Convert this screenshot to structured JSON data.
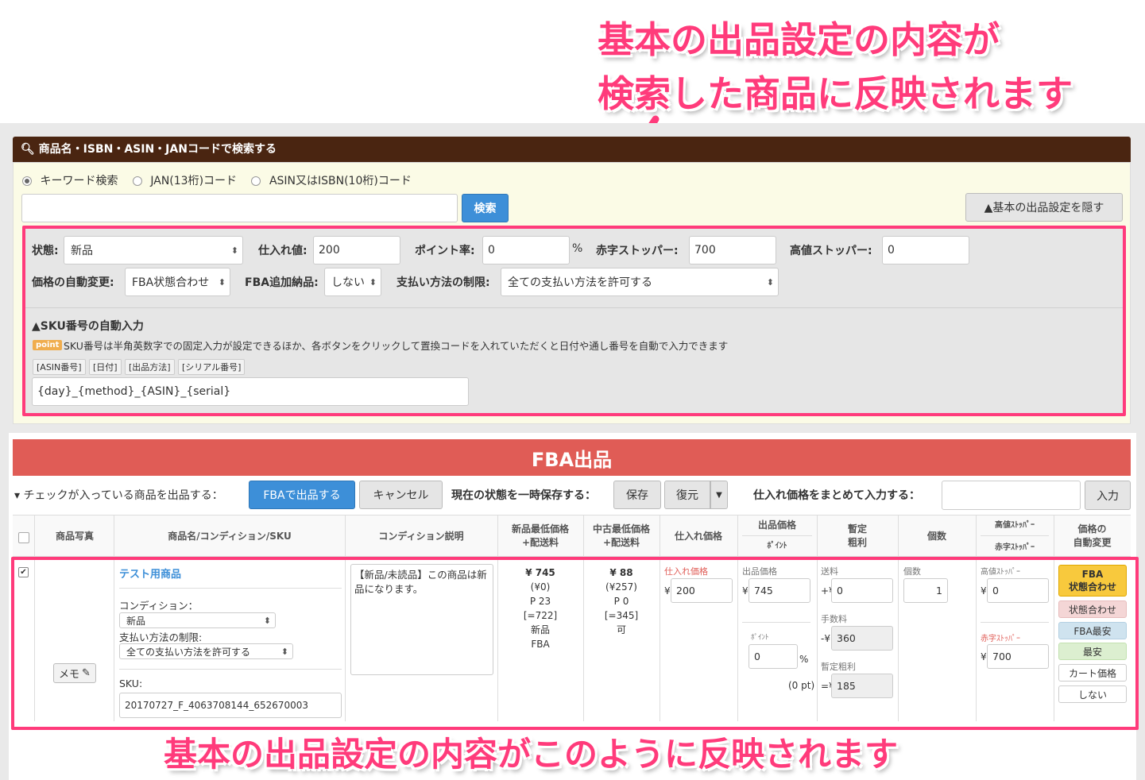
{
  "annotations": {
    "top_line1": "基本の出品設定の内容が",
    "top_line2": "検索した商品に反映されます",
    "bottom": "基本の出品設定の内容がこのように反映されます"
  },
  "search": {
    "header": "商品名・ISBN・ASIN・JANコードで検索する",
    "radio_keyword": "キーワード検索",
    "radio_jan": "JAN(13桁)コード",
    "radio_asin": "ASIN又はISBN(10桁)コード",
    "button": "検索",
    "hide_settings": "▲基本の出品設定を隠す"
  },
  "settings": {
    "condition_label": "状態:",
    "condition_value": "新品",
    "cost_label": "仕入れ値:",
    "cost_value": "200",
    "point_label": "ポイント率:",
    "point_value": "0",
    "point_unit": "%",
    "red_stopper_label": "赤字ストッパー:",
    "red_stopper_value": "700",
    "high_stopper_label": "高値ストッパー:",
    "high_stopper_value": "0",
    "auto_price_label": "価格の自動変更:",
    "auto_price_value": "FBA状態合わせ",
    "fba_add_label": "FBA追加納品:",
    "fba_add_value": "しない",
    "payment_label": "支払い方法の制限:",
    "payment_value": "全ての支払い方法を許可する",
    "sku_title": "▲SKU番号の自動入力",
    "point_badge": "point",
    "sku_desc": "SKU番号は半角英数字での固定入力が設定できるほか、各ボタンをクリックして置換コードを入れていただくと日付や通し番号を自動で入力できます",
    "tags": [
      "[ASIN番号]",
      "[日付]",
      "[出品方法]",
      "[シリアル番号]"
    ],
    "sku_template": "{day}_{method}_{ASIN}_{serial}"
  },
  "fba": {
    "title": "FBA出品",
    "toolbar_label": "▾ チェックが入っている商品を出品する：",
    "btn_fba": "FBAで出品する",
    "btn_cancel": "キャンセル",
    "save_label": "現在の状態を一時保存する：",
    "btn_save": "保存",
    "btn_restore": "復元",
    "bulk_label": "仕入れ価格をまとめて入力する：",
    "btn_input": "入力"
  },
  "table": {
    "headers": {
      "photo": "商品写真",
      "name": "商品名/コンディション/SKU",
      "cond_desc": "コンディション説明",
      "new_low_1": "新品最低価格",
      "new_low_2": "+配送料",
      "used_low_1": "中古最低価格",
      "used_low_2": "+配送料",
      "cost": "仕入れ価格",
      "price_1": "出品価格",
      "price_2": "ﾎﾟｲﾝﾄ",
      "profit_1": "暫定",
      "profit_2": "粗利",
      "qty": "個数",
      "high_1": "高値ｽﾄｯﾊﾟｰ",
      "high_2": "赤字ｽﾄｯﾊﾟｰ",
      "auto_1": "価格の",
      "auto_2": "自動変更"
    },
    "row": {
      "product_name": "テスト用商品",
      "memo": "メモ",
      "condition_label": "コンディション：",
      "condition_value": "新品",
      "payment_label": "支払い方法の制限:",
      "payment_value": "全ての支払い方法を許可する",
      "sku_label": "SKU:",
      "sku_value": "20170727_F_4063708144_652670003",
      "cond_desc": "【新品/未読品】この商品は新品になります。",
      "new_price": "¥ 745",
      "new_ship": "(¥0)",
      "new_point": "P 23",
      "new_net": "[=722]",
      "new_cond": "新品",
      "new_fba": "FBA",
      "used_price": "¥ 88",
      "used_ship": "(¥257)",
      "used_point": "P 0",
      "used_net": "[=345]",
      "used_cond": "可",
      "cost_label": "仕入れ価格",
      "cost_value": "200",
      "yen": "¥",
      "price_label": "出品価格",
      "price_value": "745",
      "point_label": "ﾎﾟｲﾝﾄ",
      "point_value": "0",
      "point_unit": "%",
      "point_pt": "(0 pt)",
      "ship_label": "送料",
      "ship_prefix": "+¥",
      "ship_value": "0",
      "fee_label": "手数料",
      "fee_prefix": "-¥",
      "fee_value": "360",
      "profit_label": "暫定粗利",
      "profit_prefix": "=¥",
      "profit_value": "185",
      "qty_label": "個数",
      "qty_value": "1",
      "high_label": "高値ｽﾄｯﾊﾟｰ",
      "high_value": "0",
      "red_label": "赤字ｽﾄｯﾊﾟｰ",
      "red_value": "700",
      "auto_buttons": [
        "FBA\n状態合わせ",
        "状態合わせ",
        "FBA最安",
        "最安",
        "カート価格",
        "しない"
      ]
    }
  },
  "colors": {
    "accent_pink": "#ff3b7b",
    "header_brown": "#4a2511",
    "fba_red": "#e05c56",
    "primary_blue": "#3d8fd8"
  }
}
